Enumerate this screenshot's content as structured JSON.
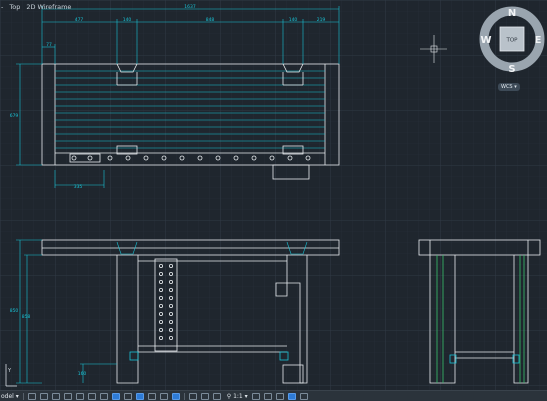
{
  "view": {
    "menu_glyph": "-",
    "view_name": "Top",
    "visual_style": "2D Wireframe"
  },
  "navcube": {
    "north": "N",
    "south": "S",
    "east": "E",
    "west": "W",
    "face": "TOP",
    "wcs_label": "WCS"
  },
  "drawing": {
    "dims": {
      "overall_width": "1637",
      "seg_a": "477",
      "seg_b": "140",
      "seg_c": "848",
      "seg_d": "140",
      "seg_e": "219",
      "left_small": "77",
      "height_top": "679",
      "bottom_dim": "335",
      "elev_height_a": "850",
      "elev_height_b": "858",
      "small_bottom": "160"
    }
  },
  "statusbar": {
    "model_tab": "odel",
    "scale": "1:1"
  },
  "colors": {
    "background": "#1f262e",
    "line_white": "#e8ecef",
    "line_cyan": "#19c3d6",
    "line_green": "#39c26d",
    "grid": "#2b343d"
  }
}
